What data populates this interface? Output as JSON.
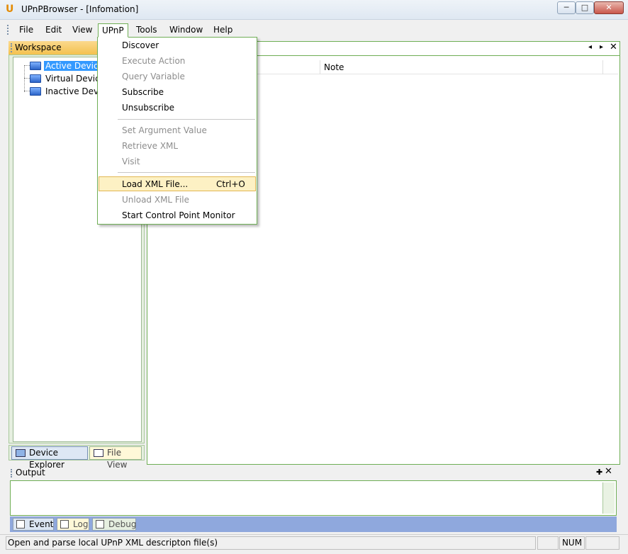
{
  "window": {
    "title": "UPnPBrowser - [Infomation]",
    "logo_glyph": "U"
  },
  "window_controls": {
    "min": "─",
    "max": "□",
    "close": "✕"
  },
  "menu": [
    "File",
    "Edit",
    "View",
    "UPnP",
    "Tools",
    "Window",
    "Help"
  ],
  "workspace": {
    "title": "Workspace",
    "tree": [
      "Active Devices",
      "Virtual Devices",
      "Inactive Devices"
    ],
    "tabs": [
      "Device Explorer",
      "File View"
    ]
  },
  "main": {
    "nav": {
      "left": "◂",
      "right": "▸",
      "close": "✕"
    },
    "columns": [
      "",
      "Note"
    ]
  },
  "upnp_menu": {
    "items": [
      {
        "label": "Discover",
        "disabled": false
      },
      {
        "label": "Execute Action",
        "disabled": true
      },
      {
        "label": "Query Variable",
        "disabled": true
      },
      {
        "label": "Subscribe",
        "disabled": false
      },
      {
        "label": "Unsubscribe",
        "disabled": false
      },
      {
        "label": "Set Argument Value",
        "disabled": true
      },
      {
        "label": "Retrieve XML",
        "disabled": true
      },
      {
        "label": "Visit",
        "disabled": true
      },
      {
        "label": "Load XML File...",
        "disabled": false,
        "shortcut": "Ctrl+O",
        "highlighted": true
      },
      {
        "label": "Unload XML File",
        "disabled": true
      },
      {
        "label": "Start Control Point Monitor",
        "disabled": false
      }
    ]
  },
  "output": {
    "title": "Output",
    "pin": "✚",
    "close": "✕",
    "tabs": [
      "Event",
      "Log",
      "Debug"
    ]
  },
  "status": {
    "text": "Open and parse local UPnP XML descripton file(s)",
    "num": "NUM"
  },
  "colors": {
    "accent_green": "#6fae55",
    "selection_blue": "#3399ff",
    "menu_highlight": "#fdf1c4"
  }
}
